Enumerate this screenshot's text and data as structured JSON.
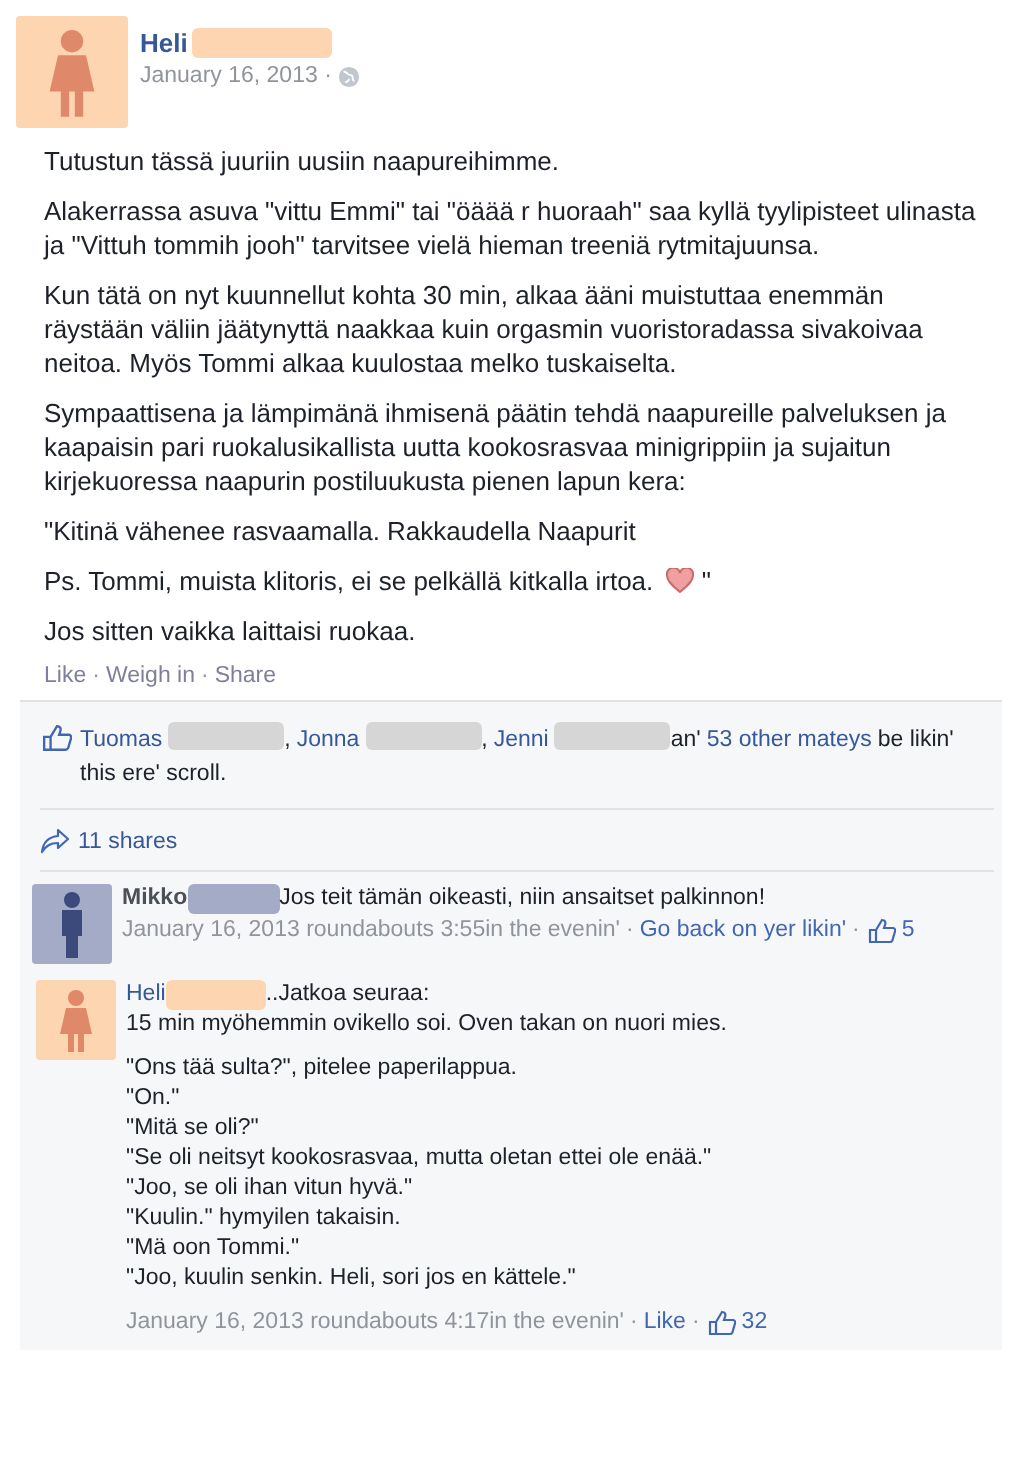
{
  "post": {
    "author": "Heli",
    "avatar": {
      "kind": "female"
    },
    "date": "January 16, 2013 ·",
    "paragraphs": [
      {
        "lines": [
          "Tutustun tässä juuriin uusiin naapureihimme."
        ]
      },
      {
        "lines": [
          "Alakerrassa asuva \"vittu Emmi\" tai \"öäää r huoraah\" saa kyllä tyylipisteet ulinasta ja \"Vittuh tommih jooh\" tarvitsee vielä hieman treeniä rytmitajuunsa."
        ]
      },
      {
        "lines": [
          "Kun tätä on nyt kuunnellut kohta 30 min, alkaa ääni muistuttaa enemmän räystään väliin jäätynyttä naakkaa kuin orgasmin vuoristoradassa sivakoivaa neitoa. Myös Tommi alkaa kuulostaa melko tuskaiselta."
        ]
      },
      {
        "lines": [
          "Sympaattisena ja lämpimänä ihmisenä päätin tehdä naapureille palveluksen ja kaapaisin pari ruokalusikallista uutta kookosrasvaa minigrippiin ja sujaitun kirjekuoressa naapurin postiluukusta pienen lapun kera:"
        ]
      },
      {
        "lines": [
          "\"Kitinä vähenee rasvaamalla. Rakkaudella Naapurit"
        ]
      },
      {
        "lines": [
          "Ps. Tommi, muista klitoris, ei se pelkällä kitkalla irtoa."
        ],
        "heart": true,
        "tail": "\""
      },
      {
        "lines": [
          "Jos sitten vaikka laittaisi ruokaa."
        ]
      }
    ],
    "actions": [
      {
        "kind": "link",
        "text": "Like"
      },
      {
        "kind": "sep",
        "text": "·"
      },
      {
        "kind": "link",
        "text": "Weigh in"
      },
      {
        "kind": "sep",
        "text": "·"
      },
      {
        "kind": "link",
        "text": "Share"
      }
    ]
  },
  "likes": [
    {
      "kind": "link",
      "text": "Tuomas"
    },
    {
      "kind": "redaction"
    },
    {
      "kind": "text",
      "text": ","
    },
    {
      "kind": "link",
      "text": "Jonna"
    },
    {
      "kind": "redaction"
    },
    {
      "kind": "text",
      "text": ","
    },
    {
      "kind": "link",
      "text": "Jenni"
    },
    {
      "kind": "redaction"
    },
    {
      "kind": "text",
      "text": "an'"
    },
    {
      "kind": "link",
      "text": "53 other mateys"
    },
    {
      "kind": "text",
      "text": "be likin'"
    },
    {
      "kind": "text",
      "text": "this ere' scroll."
    }
  ],
  "shares": "11 shares",
  "comments": [
    {
      "author": "Mikko",
      "avatar": {
        "kind": "male"
      },
      "reply": false,
      "text": "Jos teit tämän oikeasti, niin ansaitset palkinnon!",
      "meta": [
        {
          "kind": "text",
          "text": "January 16, 2013 roundabouts 3:55in the evenin'"
        },
        {
          "kind": "sep",
          "text": "·"
        },
        {
          "kind": "link",
          "text": "Go back on yer likin'"
        },
        {
          "kind": "sep",
          "text": "·"
        },
        {
          "kind": "likes",
          "text": "5"
        }
      ]
    },
    {
      "author": "Heli",
      "avatar": {
        "kind": "female"
      },
      "reply": true,
      "text": "..Jatkoa seuraa:",
      "paragraphs": [
        [
          "15 min myöhemmin ovikello soi. Oven takan on nuori mies."
        ],
        [
          "\"Ons tää sulta?\", pitelee paperilappua.",
          "\"On.\"",
          "\"Mitä se oli?\"",
          "\"Se oli neitsyt kookosrasvaa, mutta oletan ettei ole enää.\"",
          "\"Joo, se oli ihan vitun hyvä.\"",
          "\"Kuulin.\" hymyilen takaisin.",
          "\"Mä oon Tommi.\"",
          "\"Joo, kuulin senkin. Heli, sori jos en kättele.\""
        ]
      ],
      "meta": [
        {
          "kind": "text",
          "text": "January 16, 2013 roundabouts 4:17in the evenin'"
        },
        {
          "kind": "sep",
          "text": "·"
        },
        {
          "kind": "link",
          "text": "Like"
        },
        {
          "kind": "sep",
          "text": "·"
        },
        {
          "kind": "likes",
          "text": "32"
        }
      ]
    }
  ]
}
